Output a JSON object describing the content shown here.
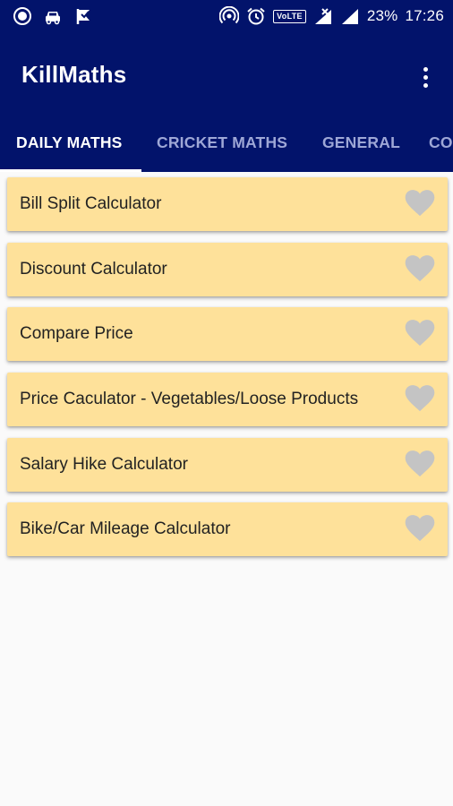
{
  "status_bar": {
    "icons_left": [
      "circle-notification-icon",
      "car-notification-icon",
      "flag-notification-icon"
    ],
    "icons_right": [
      "hotspot-icon",
      "alarm-icon",
      "volte-icon",
      "signal-muted-icon",
      "signal-icon"
    ],
    "volte_label": "VoLTE",
    "battery": "23%",
    "time": "17:26"
  },
  "app_bar": {
    "title": "KillMaths",
    "menu_icon": "overflow-menu-icon"
  },
  "tabs": [
    {
      "label": "DAILY MATHS",
      "active": true
    },
    {
      "label": "CRICKET MATHS",
      "active": false
    },
    {
      "label": "GENERAL",
      "active": false
    },
    {
      "label": "CO",
      "active": false
    }
  ],
  "items": [
    {
      "label": "Bill Split Calculator",
      "icon": "heart-icon"
    },
    {
      "label": "Discount Calculator",
      "icon": "heart-icon"
    },
    {
      "label": "Compare Price",
      "icon": "heart-icon"
    },
    {
      "label": "Price Caculator - Vegetables/Loose Products",
      "icon": "heart-icon"
    },
    {
      "label": "Salary Hike Calculator",
      "icon": "heart-icon"
    },
    {
      "label": "Bike/Car Mileage Calculator",
      "icon": "heart-icon"
    }
  ],
  "colors": {
    "primary": "#02136b",
    "card": "#fee19a",
    "heart": "#c4c4c4",
    "tab_inactive": "#9ea7d6",
    "background": "#fafafa"
  }
}
